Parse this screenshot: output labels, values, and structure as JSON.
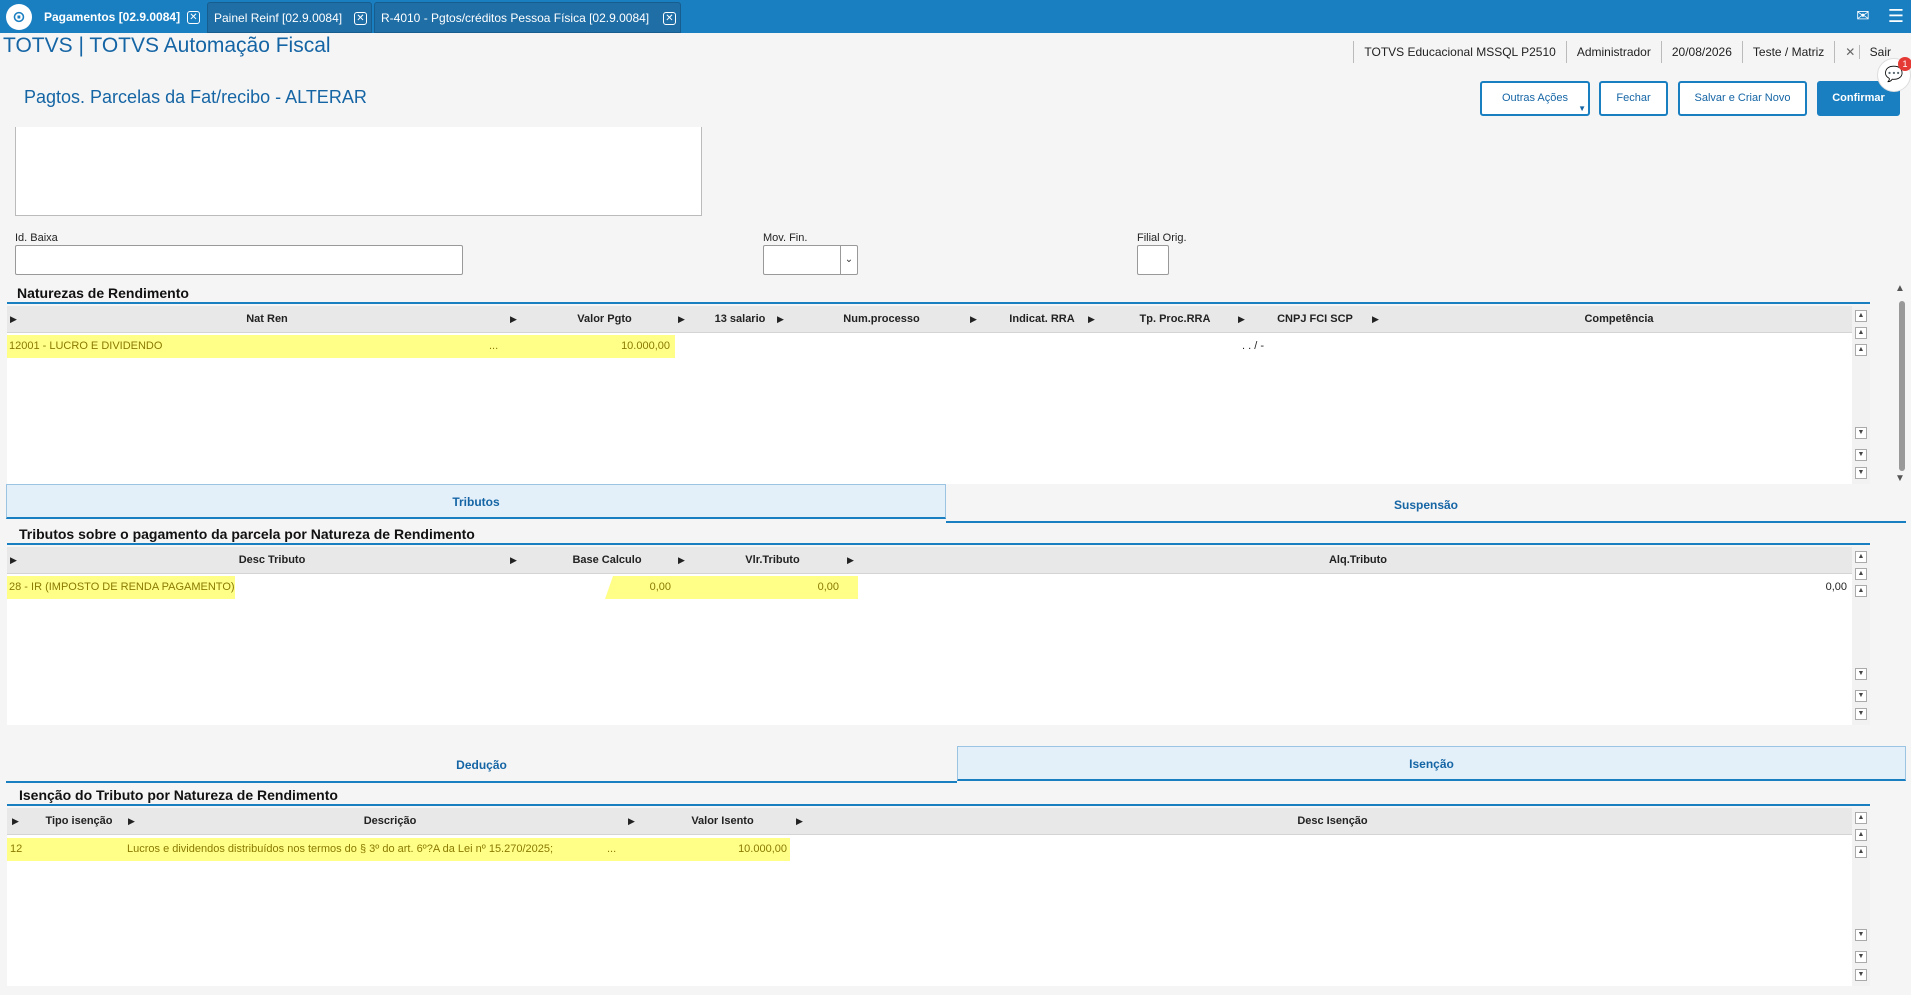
{
  "window_tabs": [
    {
      "label": "Pagamentos [02.9.0084]",
      "active": true
    },
    {
      "label": "Painel Reinf [02.9.0084]",
      "active": false
    },
    {
      "label": "R-4010 - Pgtos/créditos Pessoa Física [02.9.0084]",
      "active": false
    }
  ],
  "app_title": "TOTVS | TOTVS Automação Fiscal",
  "info": {
    "environment": "TOTVS Educacional MSSQL P2510",
    "user": "Administrador",
    "date": "20/08/2026",
    "branch": "Teste / Matriz",
    "exit": "Sair"
  },
  "page_title": "Pagtos. Parcelas da Fat/recibo - ALTERAR",
  "buttons": {
    "other_actions": "Outras Ações",
    "close": "Fechar",
    "save_new": "Salvar e Criar Novo",
    "confirm": "Confirmar"
  },
  "chat_badge": "1",
  "fields": {
    "id_baixa_label": "Id. Baixa",
    "id_baixa_value": "",
    "mov_fin_label": "Mov. Fin.",
    "mov_fin_value": "",
    "filial_orig_label": "Filial Orig.",
    "filial_orig_value": ""
  },
  "naturezas": {
    "title": "Naturezas de Rendimento",
    "columns": [
      "Nat Ren",
      "Valor Pgto",
      "13 salario",
      "Num.processo",
      "Indicat. RRA",
      "Tp. Proc.RRA",
      "CNPJ FCI SCP",
      "Competência"
    ],
    "rows": [
      {
        "nat_ren": "12001 - LUCRO E DIVIDENDO",
        "lookup": "...",
        "valor_pgto": "10.000,00",
        "cnpj": ". . /  -"
      }
    ]
  },
  "tabs_tributos": [
    {
      "label": "Tributos",
      "selected": true
    },
    {
      "label": "Suspensão",
      "selected": false
    }
  ],
  "tributos": {
    "title": "Tributos sobre o pagamento da parcela por Natureza de Rendimento",
    "columns": [
      "Desc Tributo",
      "Base Calculo",
      "Vlr.Tributo",
      "Alq.Tributo"
    ],
    "rows": [
      {
        "desc": "28 - IR (IMPOSTO DE RENDA PAGAMENTO)",
        "base": "0,00",
        "vlr": "0,00",
        "alq": "0,00"
      }
    ]
  },
  "tabs_deducao": [
    {
      "label": "Dedução",
      "selected": false
    },
    {
      "label": "Isenção",
      "selected": true
    }
  ],
  "isencao": {
    "title": "Isenção do Tributo por Natureza de Rendimento",
    "columns": [
      "Tipo isenção",
      "Descrição",
      "Valor Isento",
      "Desc Isenção"
    ],
    "rows": [
      {
        "tipo": "12",
        "descricao": "Lucros e dividendos distribuídos nos termos do § 3º do art. 6º?A da Lei nº 15.270/2025;",
        "lookup": "...",
        "valor": "10.000,00"
      }
    ]
  },
  "colors": {
    "accent": "#1a7fc1",
    "highlight": "#ffff88"
  }
}
